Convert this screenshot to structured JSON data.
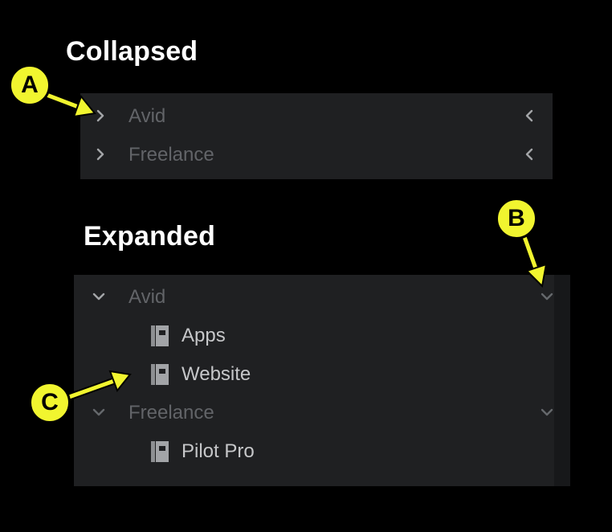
{
  "headings": {
    "collapsed": "Collapsed",
    "expanded": "Expanded"
  },
  "collapsed": {
    "groups": [
      {
        "label": "Avid"
      },
      {
        "label": "Freelance"
      }
    ]
  },
  "expanded": {
    "groups": [
      {
        "label": "Avid",
        "items": [
          {
            "label": "Apps"
          },
          {
            "label": "Website"
          }
        ]
      },
      {
        "label": "Freelance",
        "items": [
          {
            "label": "Pilot Pro"
          }
        ]
      }
    ]
  },
  "callouts": {
    "a": "A",
    "b": "B",
    "c": "C"
  },
  "colors": {
    "callout": "#f1f52f",
    "panel": "#1f2022",
    "group_text": "#626468",
    "item_text": "#c6c7c9"
  },
  "icons": {
    "collapsed_row": "chevron-right-icon",
    "collapsed_trailing": "chevron-left-icon",
    "expanded_row": "chevron-down-icon",
    "item": "notebook-icon"
  }
}
